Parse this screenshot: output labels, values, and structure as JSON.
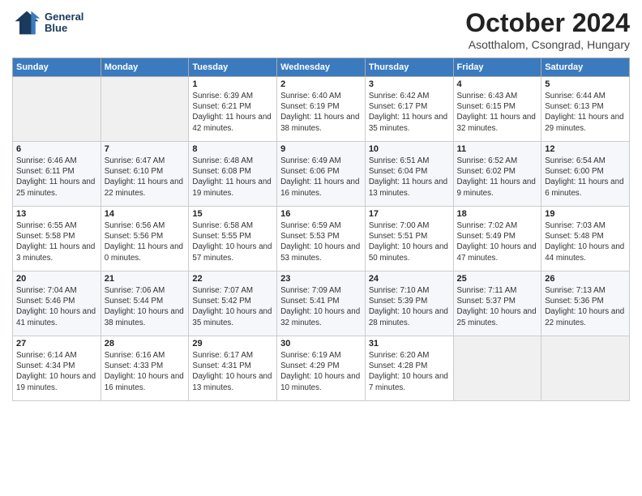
{
  "header": {
    "logo_line1": "General",
    "logo_line2": "Blue",
    "main_title": "October 2024",
    "subtitle": "Asotthalom, Csongrad, Hungary"
  },
  "weekdays": [
    "Sunday",
    "Monday",
    "Tuesday",
    "Wednesday",
    "Thursday",
    "Friday",
    "Saturday"
  ],
  "weeks": [
    [
      {
        "day": "",
        "info": ""
      },
      {
        "day": "",
        "info": ""
      },
      {
        "day": "1",
        "info": "Sunrise: 6:39 AM\nSunset: 6:21 PM\nDaylight: 11 hours and 42 minutes."
      },
      {
        "day": "2",
        "info": "Sunrise: 6:40 AM\nSunset: 6:19 PM\nDaylight: 11 hours and 38 minutes."
      },
      {
        "day": "3",
        "info": "Sunrise: 6:42 AM\nSunset: 6:17 PM\nDaylight: 11 hours and 35 minutes."
      },
      {
        "day": "4",
        "info": "Sunrise: 6:43 AM\nSunset: 6:15 PM\nDaylight: 11 hours and 32 minutes."
      },
      {
        "day": "5",
        "info": "Sunrise: 6:44 AM\nSunset: 6:13 PM\nDaylight: 11 hours and 29 minutes."
      }
    ],
    [
      {
        "day": "6",
        "info": "Sunrise: 6:46 AM\nSunset: 6:11 PM\nDaylight: 11 hours and 25 minutes."
      },
      {
        "day": "7",
        "info": "Sunrise: 6:47 AM\nSunset: 6:10 PM\nDaylight: 11 hours and 22 minutes."
      },
      {
        "day": "8",
        "info": "Sunrise: 6:48 AM\nSunset: 6:08 PM\nDaylight: 11 hours and 19 minutes."
      },
      {
        "day": "9",
        "info": "Sunrise: 6:49 AM\nSunset: 6:06 PM\nDaylight: 11 hours and 16 minutes."
      },
      {
        "day": "10",
        "info": "Sunrise: 6:51 AM\nSunset: 6:04 PM\nDaylight: 11 hours and 13 minutes."
      },
      {
        "day": "11",
        "info": "Sunrise: 6:52 AM\nSunset: 6:02 PM\nDaylight: 11 hours and 9 minutes."
      },
      {
        "day": "12",
        "info": "Sunrise: 6:54 AM\nSunset: 6:00 PM\nDaylight: 11 hours and 6 minutes."
      }
    ],
    [
      {
        "day": "13",
        "info": "Sunrise: 6:55 AM\nSunset: 5:58 PM\nDaylight: 11 hours and 3 minutes."
      },
      {
        "day": "14",
        "info": "Sunrise: 6:56 AM\nSunset: 5:56 PM\nDaylight: 11 hours and 0 minutes."
      },
      {
        "day": "15",
        "info": "Sunrise: 6:58 AM\nSunset: 5:55 PM\nDaylight: 10 hours and 57 minutes."
      },
      {
        "day": "16",
        "info": "Sunrise: 6:59 AM\nSunset: 5:53 PM\nDaylight: 10 hours and 53 minutes."
      },
      {
        "day": "17",
        "info": "Sunrise: 7:00 AM\nSunset: 5:51 PM\nDaylight: 10 hours and 50 minutes."
      },
      {
        "day": "18",
        "info": "Sunrise: 7:02 AM\nSunset: 5:49 PM\nDaylight: 10 hours and 47 minutes."
      },
      {
        "day": "19",
        "info": "Sunrise: 7:03 AM\nSunset: 5:48 PM\nDaylight: 10 hours and 44 minutes."
      }
    ],
    [
      {
        "day": "20",
        "info": "Sunrise: 7:04 AM\nSunset: 5:46 PM\nDaylight: 10 hours and 41 minutes."
      },
      {
        "day": "21",
        "info": "Sunrise: 7:06 AM\nSunset: 5:44 PM\nDaylight: 10 hours and 38 minutes."
      },
      {
        "day": "22",
        "info": "Sunrise: 7:07 AM\nSunset: 5:42 PM\nDaylight: 10 hours and 35 minutes."
      },
      {
        "day": "23",
        "info": "Sunrise: 7:09 AM\nSunset: 5:41 PM\nDaylight: 10 hours and 32 minutes."
      },
      {
        "day": "24",
        "info": "Sunrise: 7:10 AM\nSunset: 5:39 PM\nDaylight: 10 hours and 28 minutes."
      },
      {
        "day": "25",
        "info": "Sunrise: 7:11 AM\nSunset: 5:37 PM\nDaylight: 10 hours and 25 minutes."
      },
      {
        "day": "26",
        "info": "Sunrise: 7:13 AM\nSunset: 5:36 PM\nDaylight: 10 hours and 22 minutes."
      }
    ],
    [
      {
        "day": "27",
        "info": "Sunrise: 6:14 AM\nSunset: 4:34 PM\nDaylight: 10 hours and 19 minutes."
      },
      {
        "day": "28",
        "info": "Sunrise: 6:16 AM\nSunset: 4:33 PM\nDaylight: 10 hours and 16 minutes."
      },
      {
        "day": "29",
        "info": "Sunrise: 6:17 AM\nSunset: 4:31 PM\nDaylight: 10 hours and 13 minutes."
      },
      {
        "day": "30",
        "info": "Sunrise: 6:19 AM\nSunset: 4:29 PM\nDaylight: 10 hours and 10 minutes."
      },
      {
        "day": "31",
        "info": "Sunrise: 6:20 AM\nSunset: 4:28 PM\nDaylight: 10 hours and 7 minutes."
      },
      {
        "day": "",
        "info": ""
      },
      {
        "day": "",
        "info": ""
      }
    ]
  ]
}
